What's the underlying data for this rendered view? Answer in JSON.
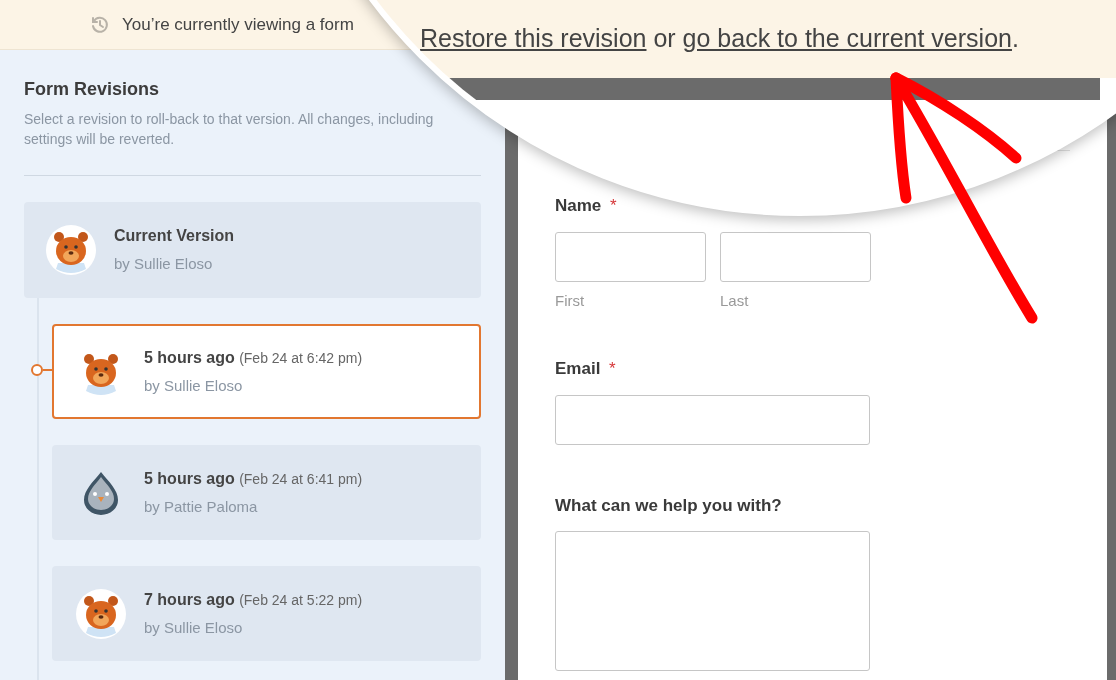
{
  "banner": {
    "message": "You’re currently viewing a form"
  },
  "magnifier": {
    "restore_link": "Restore this revision",
    "joiner": "or",
    "back_link": "go back to the current version",
    "end": "."
  },
  "sidebar": {
    "title": "Form Revisions",
    "description": "Select a revision to roll-back to that version. All changes, including settings will be reverted.",
    "current": {
      "title": "Current Version",
      "author": "by Sullie Eloso",
      "kind": "bear"
    },
    "revisions": [
      {
        "time": "5 hours ago",
        "date": "(Feb 24 at 6:42 pm)",
        "author": "by Sullie Eloso",
        "kind": "bear",
        "selected": true
      },
      {
        "time": "5 hours ago",
        "date": "(Feb 24 at 6:41 pm)",
        "author": "by Pattie Paloma",
        "kind": "bird",
        "selected": false
      },
      {
        "time": "7 hours ago",
        "date": "(Feb 24 at 5:22 pm)",
        "author": "by Sullie Eloso",
        "kind": "bear",
        "selected": false
      }
    ]
  },
  "form": {
    "fields": [
      {
        "kind": "name",
        "label": "Name",
        "required_mark": "*",
        "sublabels": [
          "First",
          "Last"
        ]
      },
      {
        "kind": "email",
        "label": "Email",
        "required_mark": "*"
      },
      {
        "kind": "textarea",
        "label": "What can we help you with?"
      }
    ]
  }
}
